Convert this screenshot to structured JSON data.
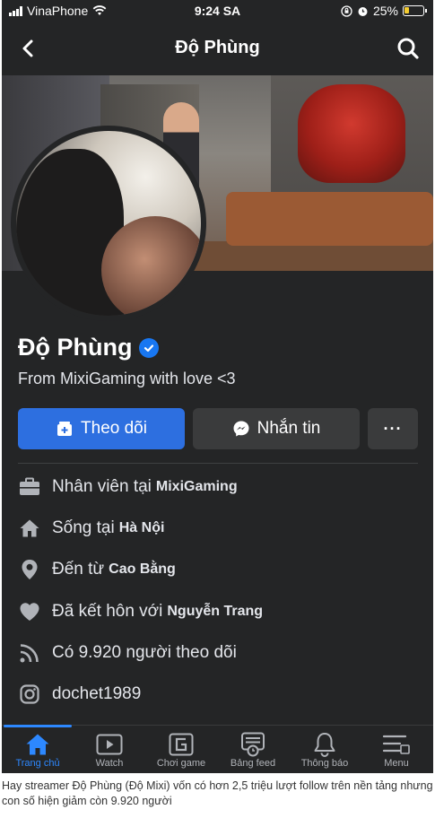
{
  "status": {
    "carrier": "VinaPhone",
    "time": "9:24 SA",
    "battery": "25%",
    "battery_level": 0.25
  },
  "nav": {
    "title": "Độ Phùng",
    "back_icon": "chevron-left-icon",
    "search_icon": "search-icon"
  },
  "profile": {
    "name": "Độ Phùng",
    "bio": "From MixiGaming with love <3",
    "follow_label": "Theo dõi",
    "message_label": "Nhắn tin",
    "more_label": "···"
  },
  "info": [
    {
      "icon": "briefcase-icon",
      "prefix": "Nhân viên tại",
      "value": "MixiGaming"
    },
    {
      "icon": "home-icon",
      "prefix": "Sống tại",
      "value": "Hà Nội"
    },
    {
      "icon": "location-pin-icon",
      "prefix": "Đến từ",
      "value": "Cao Bằng"
    },
    {
      "icon": "heart-icon",
      "prefix": "Đã kết hôn với",
      "value": "Nguyễn Trang"
    },
    {
      "icon": "rss-icon",
      "prefix": "Có 9.920 người theo dõi",
      "value": ""
    },
    {
      "icon": "instagram-icon",
      "prefix": "dochet1989",
      "value": ""
    }
  ],
  "tabs": [
    {
      "label": "Trang chủ",
      "icon": "home-icon",
      "active": true
    },
    {
      "label": "Watch",
      "icon": "play-icon",
      "active": false
    },
    {
      "label": "Chơi game",
      "icon": "gaming-icon",
      "active": false
    },
    {
      "label": "Bảng feed",
      "icon": "feed-icon",
      "active": false
    },
    {
      "label": "Thông báo",
      "icon": "bell-icon",
      "active": false
    },
    {
      "label": "Menu",
      "icon": "menu-icon",
      "active": false
    }
  ],
  "caption": "Hay streamer Độ Phùng (Độ Mixi) vốn có hơn 2,5 triệu lượt follow trên nền tảng nhưng con số hiện giảm còn 9.920 người",
  "colors": {
    "background": "#242526",
    "accent": "#2d88ff",
    "follow_button": "#2d6fe0"
  }
}
